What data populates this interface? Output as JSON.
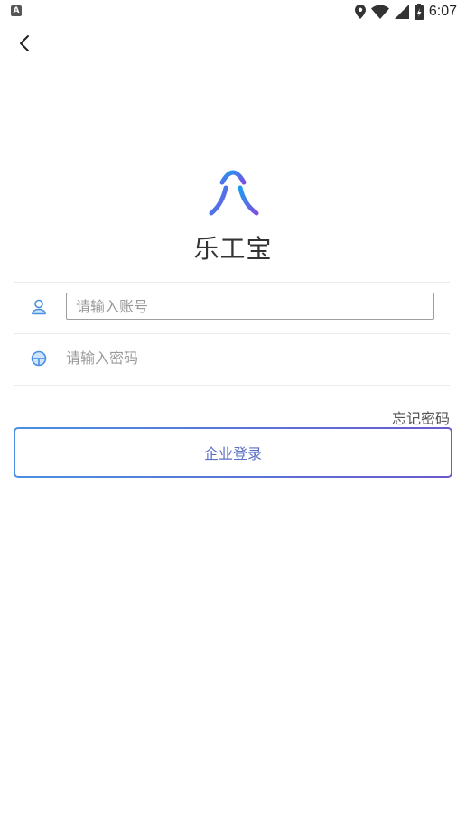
{
  "status_bar": {
    "time": "6:07",
    "left_icon": "A",
    "icons": [
      "location-icon",
      "wifi-icon",
      "signal-icon",
      "battery-icon"
    ]
  },
  "header": {
    "back_icon": "chevron-left-icon"
  },
  "brand": {
    "app_name": "乐工宝",
    "colors": {
      "logo_start": "#1e9bf0",
      "logo_end": "#7b4fe0"
    }
  },
  "form": {
    "account": {
      "placeholder": "请输入账号",
      "value": "",
      "icon": "user-icon"
    },
    "password": {
      "placeholder": "请输入密码",
      "value": "",
      "icon": "lock-icon"
    },
    "forgot_label": "忘记密码",
    "login_label": "企业登录"
  },
  "colors": {
    "icon_blue": "#4a90e2",
    "button_text": "#5b6fc8",
    "divider": "#ebebeb"
  }
}
